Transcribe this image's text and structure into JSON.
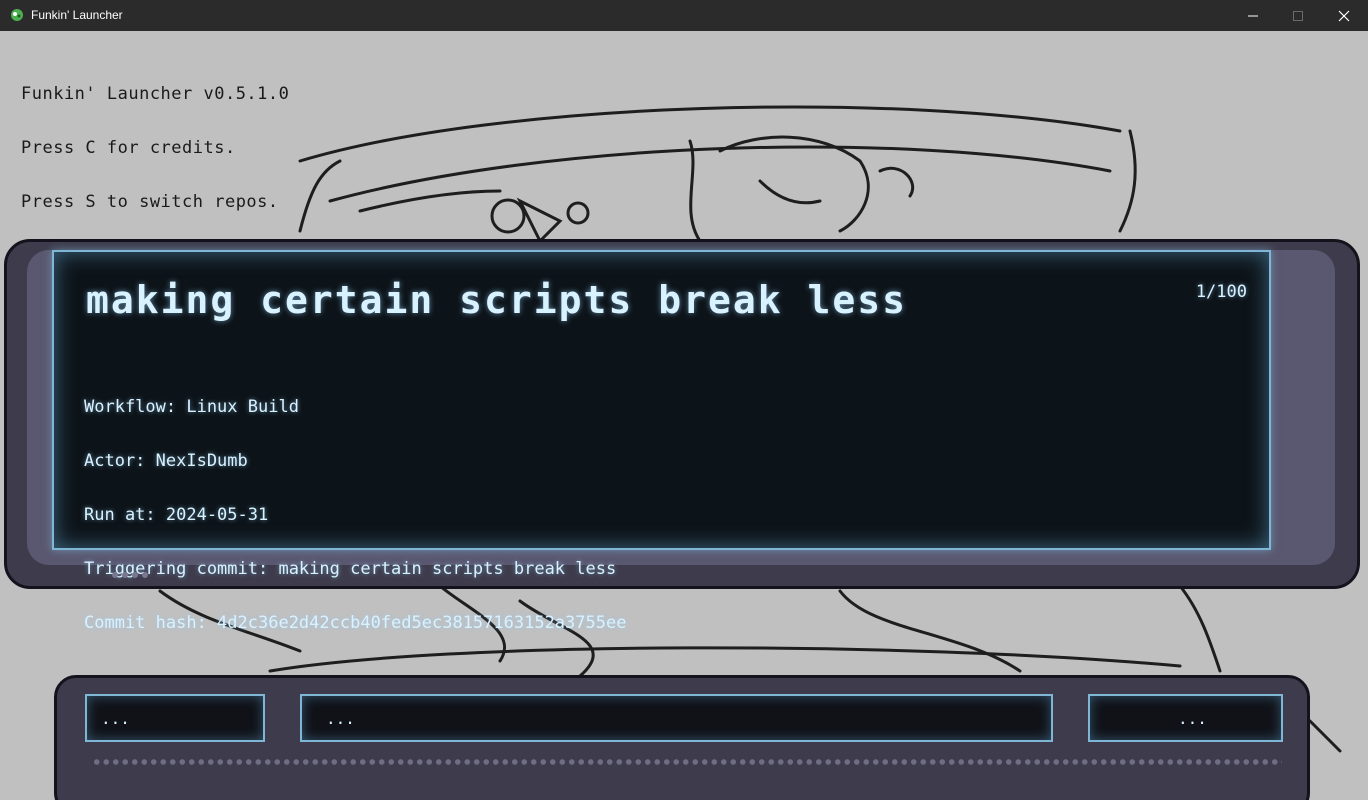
{
  "window": {
    "title": "Funkin' Launcher",
    "controls": [
      "minimize",
      "maximize",
      "close"
    ]
  },
  "info": {
    "line1": "Funkin' Launcher v0.5.1.0",
    "line2": "Press C for credits.",
    "line3": "Press S to switch repos."
  },
  "monitor": {
    "commit_title": "making certain scripts break less",
    "counter": "1/100",
    "details": {
      "workflow": "Workflow: Linux Build",
      "actor": "Actor: NexIsDumb",
      "run_at": "Run at: 2024-05-31",
      "triggering_commit": "Triggering commit: making certain scripts break less",
      "commit_hash": "Commit hash: 4d2c36e2d42ccb40fed5ec38157163152a3755ee"
    }
  },
  "bottom_panel": {
    "field_left": "...",
    "field_middle": "...",
    "field_right": "..."
  },
  "colors": {
    "screen_text": "#d8f2ff",
    "screen_bg": "#0d1419",
    "screen_border": "#7fb6d6",
    "bezel": "#3e3c4c",
    "background": "#c0c0c0"
  }
}
